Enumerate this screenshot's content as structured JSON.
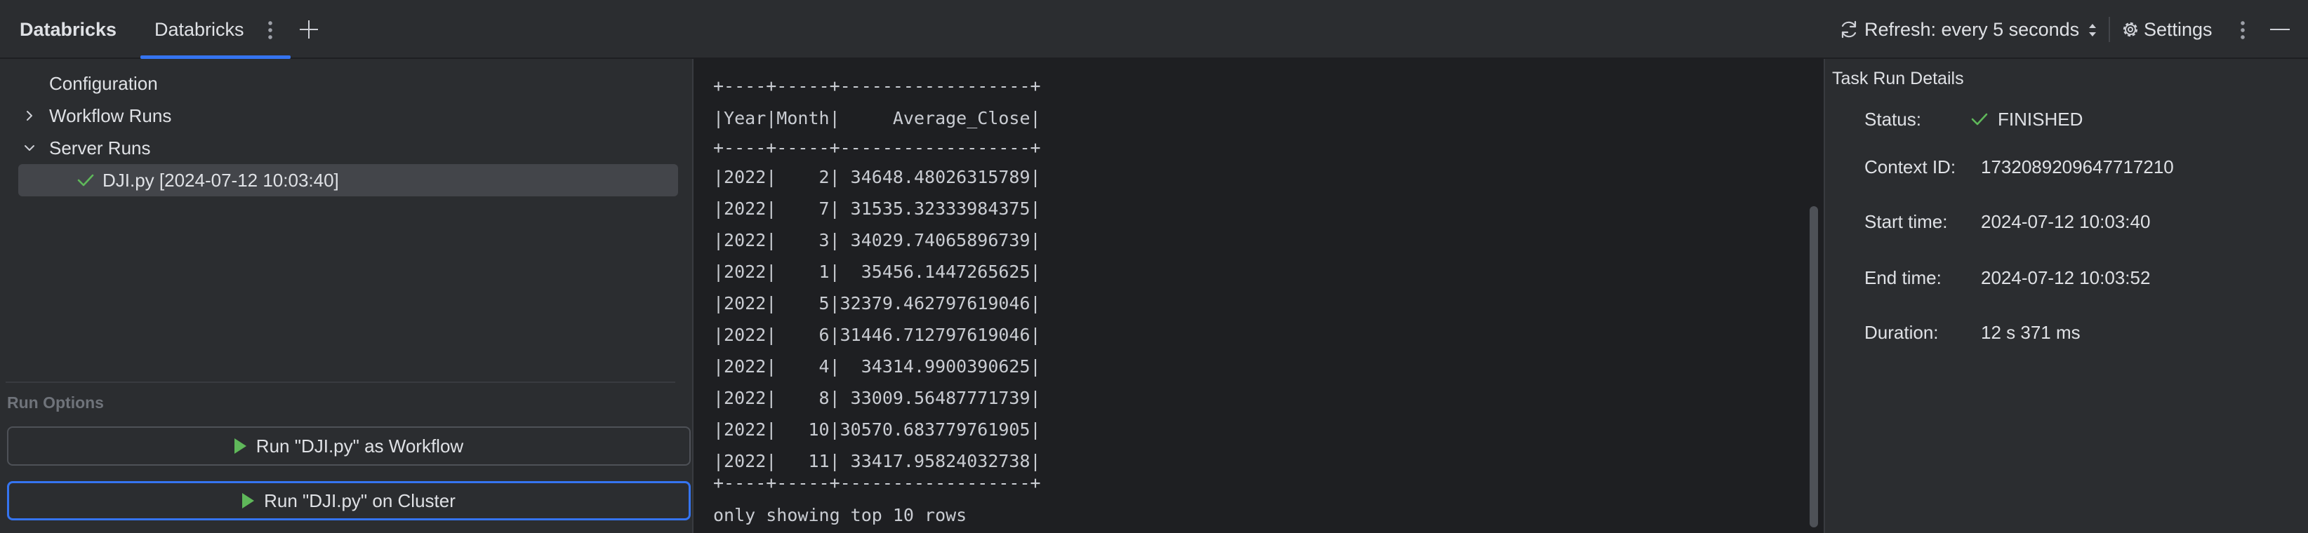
{
  "app": {
    "title": "Databricks"
  },
  "tabs": [
    {
      "label": "Databricks"
    }
  ],
  "toolbar": {
    "refresh_label": "Refresh: every 5 seconds",
    "settings_label": "Settings"
  },
  "tree": {
    "items": [
      {
        "label": "Configuration",
        "expandable": false
      },
      {
        "label": "Workflow Runs",
        "expandable": true,
        "expanded": false
      },
      {
        "label": "Server Runs",
        "expandable": true,
        "expanded": true
      }
    ],
    "selected_run": {
      "label": "DJI.py [2024-07-12 10:03:40]",
      "status_icon": "check-icon"
    }
  },
  "run_options": {
    "heading": "Run Options",
    "workflow_button": "Run \"DJI.py\" as Workflow",
    "cluster_button": "Run \"DJI.py\" on Cluster"
  },
  "console": {
    "lines": [
      "+----+-----+------------------+",
      "|Year|Month|     Average_Close|",
      "+----+-----+------------------+",
      "|2022|    2| 34648.48026315789|",
      "|2022|    7| 31535.32333984375|",
      "|2022|    3| 34029.74065896739|",
      "|2022|    1|  35456.1447265625|",
      "|2022|    5|32379.462797619046|",
      "|2022|    6|31446.712797619046|",
      "|2022|    4|  34314.9900390625|",
      "|2022|    8| 33009.56487771739|",
      "|2022|   10|30570.683779761905|",
      "|2022|   11| 33417.95824032738|",
      "+----+-----+------------------+",
      "only showing top 10 rows"
    ]
  },
  "details": {
    "title": "Task Run Details",
    "status_label": "Status:",
    "status_value": "FINISHED",
    "context_label": "Context ID:",
    "context_value": "1732089209647717210",
    "start_label": "Start time:",
    "start_value": "2024-07-12 10:03:40",
    "end_label": "End time:",
    "end_value": "2024-07-12 10:03:52",
    "duration_label": "Duration:",
    "duration_value": "12 s 371 ms"
  },
  "colors": {
    "accent": "#3574f0",
    "success": "#5fb85a",
    "panel_bg": "#2b2d30",
    "console_bg": "#1e1f22"
  }
}
